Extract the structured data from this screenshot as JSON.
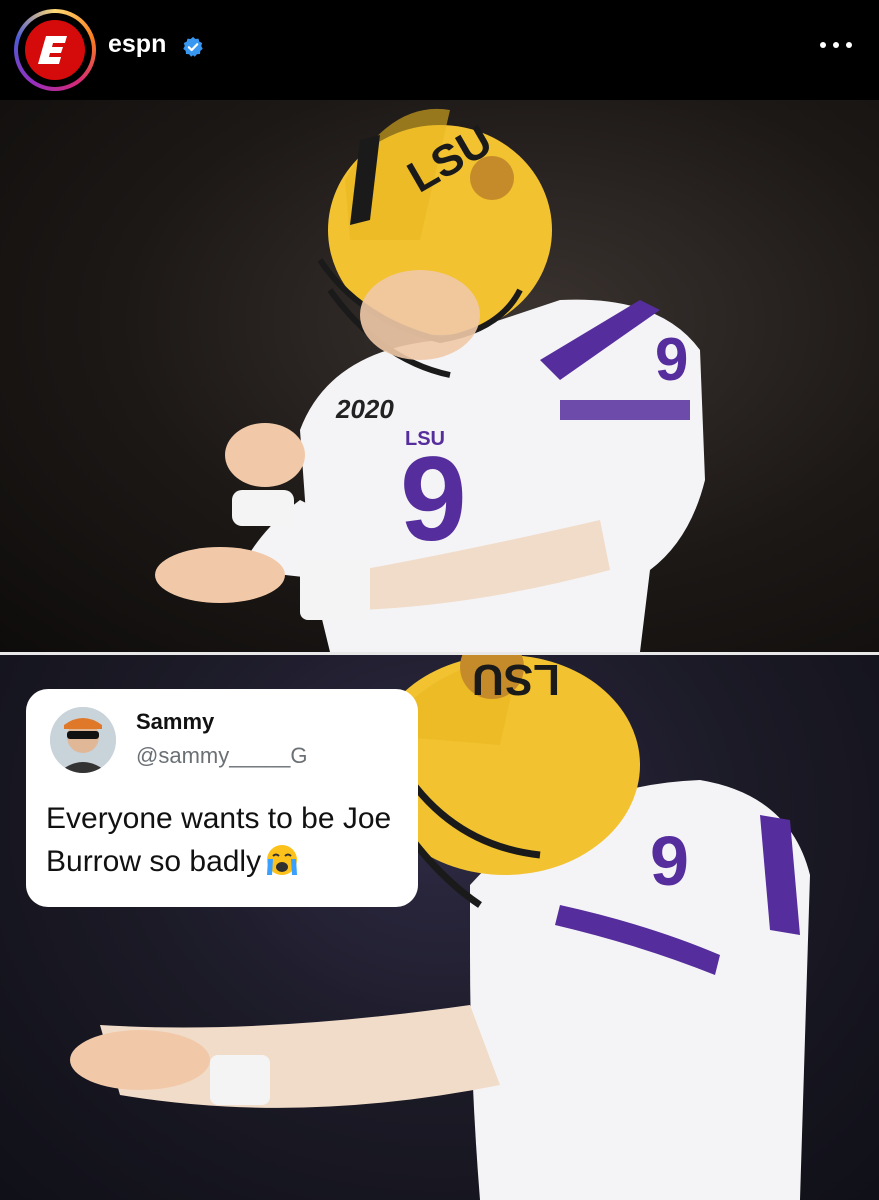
{
  "post": {
    "username": "espn",
    "verified": true
  },
  "tweet": {
    "display_name": "Sammy",
    "handle": "@sammy_____G",
    "text": "Everyone wants to be Joe Burrow so badly",
    "emoji": "loudly-crying-face"
  },
  "photo_text": {
    "helmet": "LSU",
    "jersey_number": "9",
    "patch": "2020",
    "chest": "LSU"
  },
  "colors": {
    "espn_red": "#d50a0a",
    "verified_blue": "#3897f0",
    "lsu_gold": "#f2c230",
    "lsu_purple": "#552d9c"
  }
}
